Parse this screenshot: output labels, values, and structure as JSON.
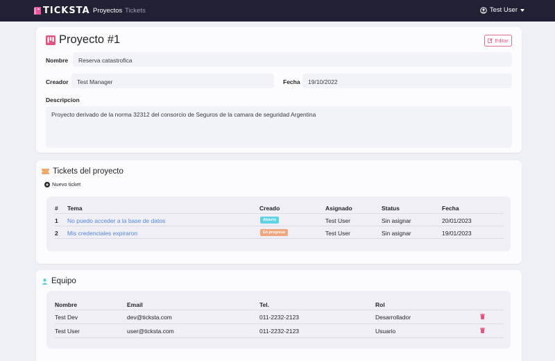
{
  "nav": {
    "brand": "TICKSTA",
    "links": [
      "Proyectos",
      "Tickets"
    ],
    "user": "Test User"
  },
  "project": {
    "title": "Proyecto #1",
    "edit_label": "Editar",
    "labels": {
      "nombre": "Nombre",
      "creador": "Creador",
      "fecha": "Fecha",
      "descripcion": "Descripcion"
    },
    "nombre": "Reserva catastrofica",
    "creador": "Test Manager",
    "fecha": "19/10/2022",
    "descripcion": "Proyecto derivado de la norma 32312 del consorcio de Seguros de la camara de seguridad Argentina"
  },
  "tickets": {
    "title": "Tickets del proyecto",
    "new_ticket": "Nuevo ticket",
    "headers": [
      "#",
      "Tema",
      "Creado",
      "Asignado",
      "Status",
      "Fecha"
    ],
    "rows": [
      {
        "num": "1",
        "tema": "No puedo acceder a la base de datos",
        "creado": "Abierto",
        "creado_color": "#5ed3e6",
        "asignado": "Test User",
        "status": "Sin asignar",
        "fecha": "20/01/2023"
      },
      {
        "num": "2",
        "tema": "Mis credenciales expiraron",
        "creado": "En progreso",
        "creado_color": "#f0a77e",
        "asignado": "Test User",
        "status": "Sin asignar",
        "fecha": "19/01/2023"
      }
    ]
  },
  "team": {
    "title": "Equipo",
    "headers": [
      "Nombre",
      "Email",
      "Tel.",
      "Rol"
    ],
    "rows": [
      {
        "nombre": "Test Dev",
        "email": "dev@ticksta.com",
        "tel": "011-2232-2123",
        "rol": "Desarrollador"
      },
      {
        "nombre": "Test User",
        "email": "user@ticksta.com",
        "tel": "011-2232-2123",
        "rol": "Usuario"
      }
    ]
  },
  "colors": {
    "navbar": "#212135",
    "accent": "#e0547f",
    "link": "#4e86d8"
  }
}
